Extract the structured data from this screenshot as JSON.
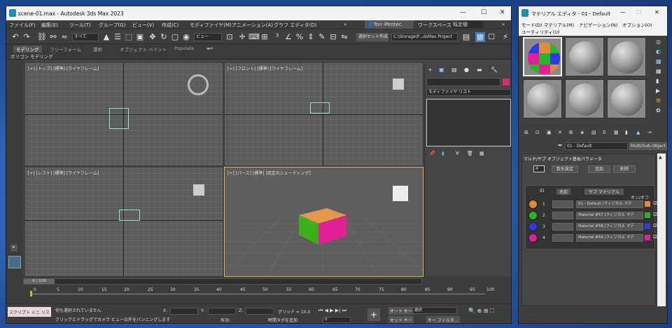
{
  "main_window": {
    "title": "scene-01.max - Autodesk 3ds Max 2023",
    "menu": [
      "ファイル(F)",
      "編集(E)",
      "ツール(T)",
      "グループ(G)",
      "ビュー(V)",
      "作成(C)",
      "モディファイヤ(M)",
      "アニメーション(A)",
      "グラフ エディタ(D)"
    ],
    "user": "Tori iPentec",
    "workspace_label": "ワークスペース:",
    "workspace_value": "既定値",
    "selection_filter": "すべて",
    "view_dropdown": "ビュー",
    "named_selection": "選択セット作成",
    "project_path": "C:\\Storage\\P...dsMax Project",
    "ribbon_tabs": [
      "モデリング",
      "フリーフォーム",
      "選択",
      "オブジェクト ペイント",
      "Populate"
    ],
    "ribbon_sub": "ポリゴン モデリング",
    "viewports": {
      "top": "[+] [トップ] [標準] [ワイヤフレーム]",
      "front": "[+] [フロント] [標準] [ワイヤフレーム]",
      "left": "[+] [レフト] [標準] [ワイヤフレーム]",
      "persp": "[+] [パース] [標準] [既定のシェーディング]"
    },
    "command_panel": {
      "modifier_list": "モディファイヤ リスト"
    },
    "timeline": {
      "frame": "0 / 100",
      "ticks": [
        "0",
        "5",
        "10",
        "15",
        "20",
        "25",
        "30",
        "35",
        "40",
        "45",
        "50",
        "55",
        "60",
        "65",
        "70",
        "75",
        "80",
        "85",
        "90",
        "95",
        "100"
      ]
    },
    "status": {
      "script": "スクリプト ミニ リス",
      "msg1": "何も選択されていません",
      "msg2": "クリックとドラッグでカメラ ビュー以外をパンニングします",
      "x": "X:",
      "y": "Y:",
      "z": "Z:",
      "grid": "グリッド = 10.0",
      "enabled": "有効:",
      "add_time_tag": "時間タグを追加",
      "auto_key": "オート キー",
      "set_key": "セット キー",
      "selection": "選択",
      "key_filter": "キー フィルタ...",
      "frame_value": "0"
    }
  },
  "material_editor": {
    "title": "マテリアル エディタ - 01 - Default",
    "menu": [
      "モード(D)",
      "マテリアル(M)",
      "ナビゲーション(N)",
      "オプション(O)",
      "ユーティリティ(U)"
    ],
    "material_name": "01 - Default",
    "material_type": "Multi/Sub-Object",
    "rollout": "マルチ/サブ オブジェクト基本パラメータ",
    "count": "4",
    "buttons": [
      "数を設定",
      "追加",
      "削除"
    ],
    "headers": [
      "ID",
      "名前",
      "サブ マテリアル",
      "オン/オフ"
    ],
    "rows": [
      {
        "id": "1",
        "sub": "01 - Default (フィジカル マテ",
        "color": "#e08a3c"
      },
      {
        "id": "2",
        "sub": "Material #57 (フィジカル マテ",
        "color": "#27b52a"
      },
      {
        "id": "3",
        "sub": "Material #58 (フィジカル マテ",
        "color": "#2d3be0"
      },
      {
        "id": "4",
        "sub": "Material #59 (フィジカル マテ",
        "color": "#e0219a"
      }
    ]
  }
}
